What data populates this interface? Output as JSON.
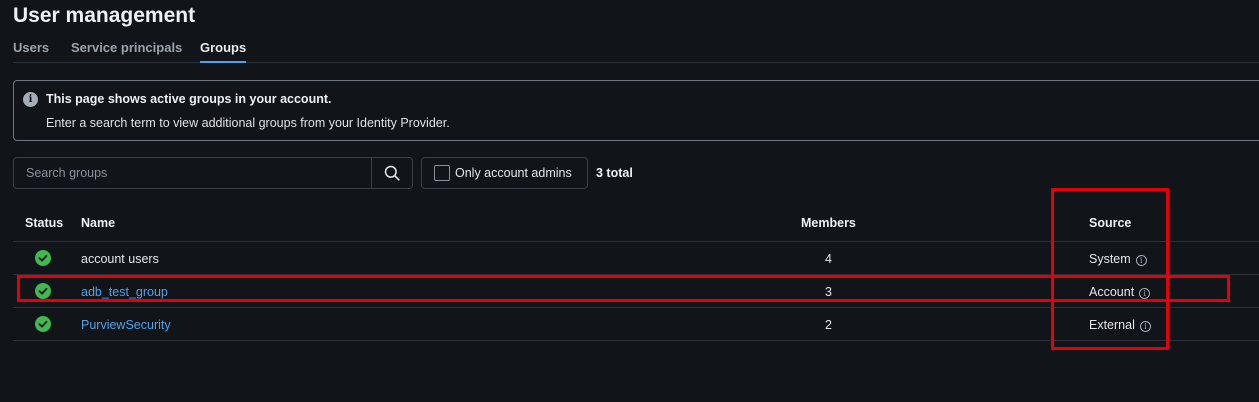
{
  "page": {
    "title": "User management"
  },
  "tabs": [
    {
      "label": "Users",
      "active": false
    },
    {
      "label": "Service principals",
      "active": false
    },
    {
      "label": "Groups",
      "active": true
    }
  ],
  "info_banner": {
    "title": "This page shows active groups in your account.",
    "text": "Enter a search term to view additional groups from your Identity Provider."
  },
  "search": {
    "placeholder": "Search groups"
  },
  "filters": {
    "only_admins_label": "Only account admins",
    "only_admins_checked": false
  },
  "total": "3 total",
  "table": {
    "columns": {
      "status": "Status",
      "name": "Name",
      "members": "Members",
      "source": "Source"
    },
    "rows": [
      {
        "status": "active",
        "name": "account users",
        "link": false,
        "members": "4",
        "source": "System"
      },
      {
        "status": "active",
        "name": "adb_test_group",
        "link": true,
        "members": "3",
        "source": "Account"
      },
      {
        "status": "active",
        "name": "PurviewSecurity",
        "link": true,
        "members": "2",
        "source": "External"
      }
    ]
  },
  "colors": {
    "background": "#111419",
    "link": "#4fa3e8",
    "status_ok": "#3fb950",
    "highlight": "#e3000b"
  }
}
